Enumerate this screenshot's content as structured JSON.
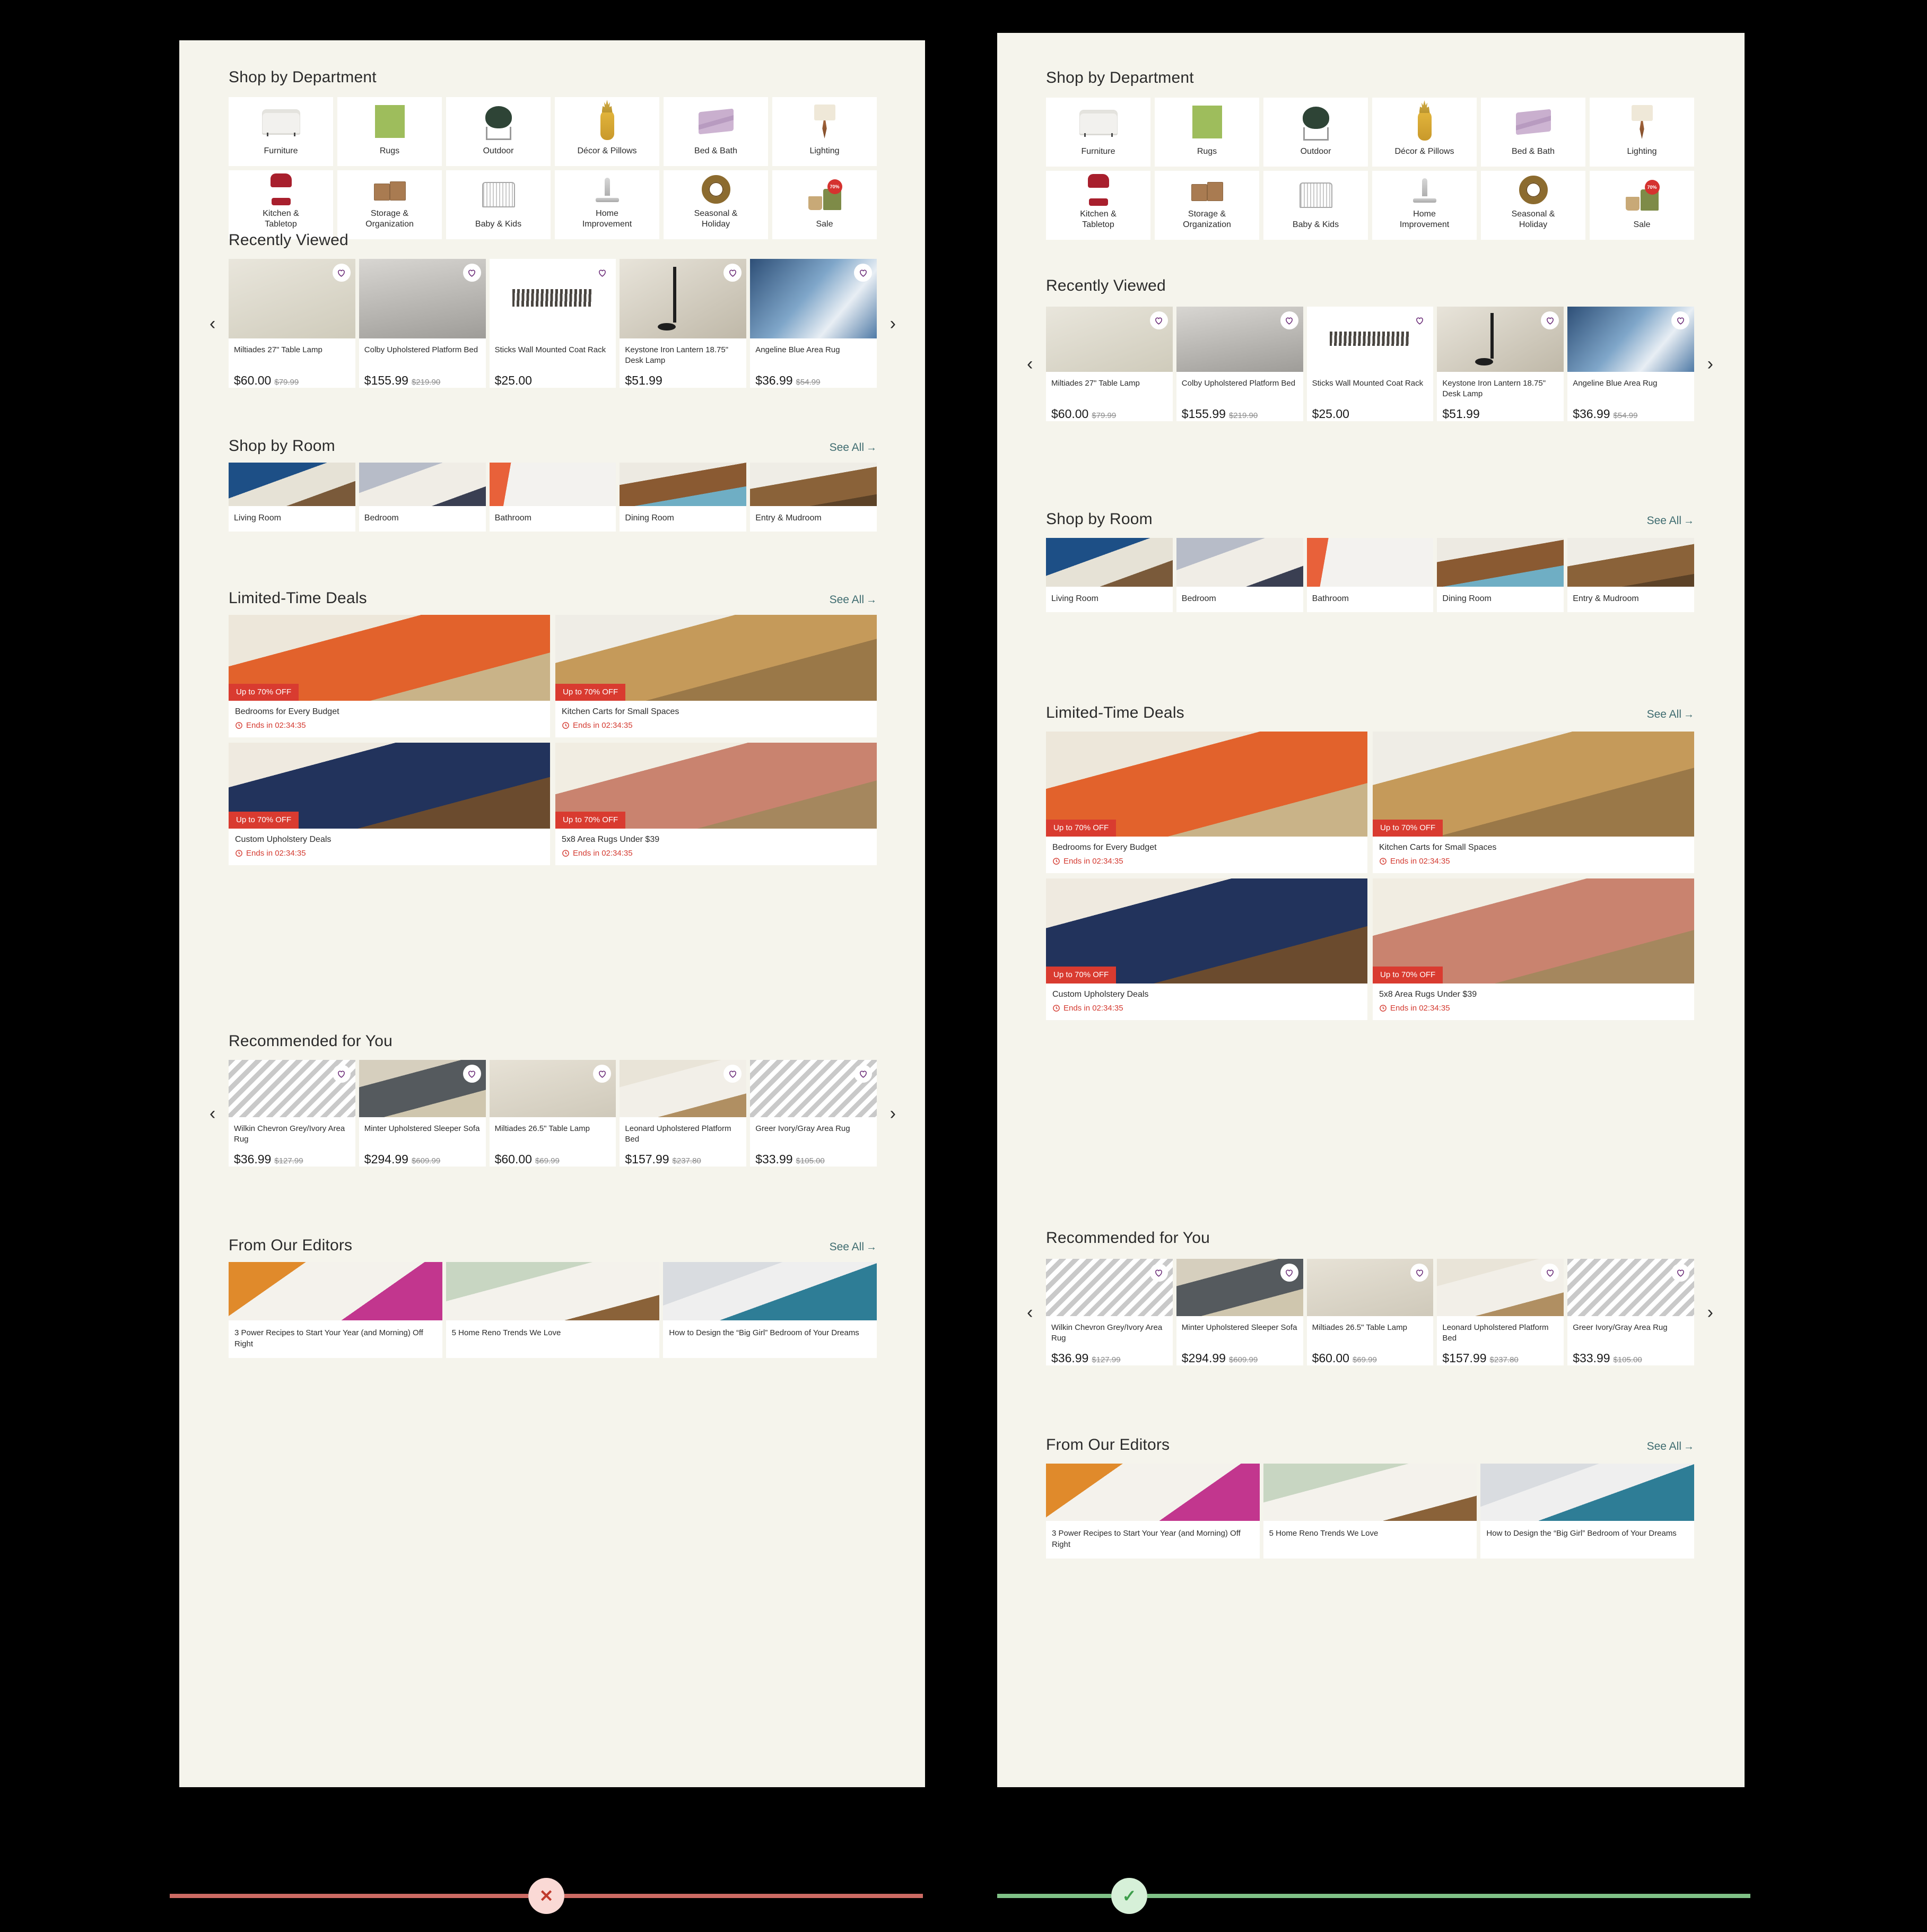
{
  "page": {
    "background_color": "#000000",
    "panel_background": "#F5F4EC",
    "card_background": "#FFFFFF",
    "accent_red": "#D93B30",
    "link_teal": "#3F6C70",
    "heart_purple": "#6B2C78"
  },
  "sections": {
    "department": {
      "title": "Shop by Department"
    },
    "recently_viewed": {
      "title": "Recently Viewed"
    },
    "shop_by_room": {
      "title": "Shop by Room",
      "see_all": "See All",
      "see_all_arrow": "→"
    },
    "limited_deals": {
      "title": "Limited-Time Deals",
      "see_all": "See All",
      "see_all_arrow": "→"
    },
    "recommended": {
      "title": "Recommended for You"
    },
    "editors": {
      "title": "From Our Editors",
      "see_all": "See All",
      "see_all_arrow": "→"
    }
  },
  "departments": [
    {
      "label": "Furniture",
      "icon": "sofa-icon"
    },
    {
      "label": "Rugs",
      "icon": "rug-icon"
    },
    {
      "label": "Outdoor",
      "icon": "grill-icon"
    },
    {
      "label": "Décor & Pillows",
      "icon": "pineapple-icon"
    },
    {
      "label": "Bed & Bath",
      "icon": "sheets-icon"
    },
    {
      "label": "Lighting",
      "icon": "lamp-icon"
    },
    {
      "label": "Kitchen &\nTabletop",
      "icon": "mixer-icon"
    },
    {
      "label": "Storage &\nOrganization",
      "icon": "bins-icon"
    },
    {
      "label": "Baby & Kids",
      "icon": "crib-icon"
    },
    {
      "label": "Home\nImprovement",
      "icon": "faucet-icon"
    },
    {
      "label": "Seasonal &\nHoliday",
      "icon": "wreath-icon"
    },
    {
      "label": "Sale",
      "icon": "sale-chair-icon",
      "badge": "up to\n70%\noff"
    }
  ],
  "recently_viewed": [
    {
      "name": "Miltiades 27\" Table Lamp",
      "price": "$60.00",
      "was": "$79.99",
      "scene": "sc-lamp-room",
      "heart": true,
      "heart_circle": true
    },
    {
      "name": "Colby Upholstered Platform Bed",
      "price": "$155.99",
      "was": "$219.90",
      "scene": "sc-bed-gray",
      "heart": true,
      "heart_circle": true
    },
    {
      "name": "Sticks Wall Mounted Coat Rack",
      "price": "$25.00",
      "was": "",
      "scene": "sc-coatrack",
      "heart": true,
      "heart_circle": false
    },
    {
      "name": "Keystone Iron Lantern 18.75\" Desk Lamp",
      "price": "$51.99",
      "was": "",
      "scene": "sc-desklamp",
      "heart": true,
      "heart_circle": true
    },
    {
      "name": "Angeline Blue Area Rug",
      "price": "$36.99",
      "was": "$54.99",
      "scene": "sc-bluerug",
      "heart": true,
      "heart_circle": true
    }
  ],
  "rooms": [
    {
      "label": "Living Room",
      "scene": "sc-living"
    },
    {
      "label": "Bedroom",
      "scene": "sc-bedroom"
    },
    {
      "label": "Bathroom",
      "scene": "sc-bath"
    },
    {
      "label": "Dining Room",
      "scene": "sc-dining"
    },
    {
      "label": "Entry & Mudroom",
      "scene": "sc-entry"
    }
  ],
  "deals": [
    {
      "title": "Bedrooms for Every Budget",
      "badge": "Up to 70% OFF",
      "timer": "Ends in 02:34:35",
      "scene": "sc-deal-bed"
    },
    {
      "title": "Kitchen Carts for Small Spaces",
      "badge": "Up to 70% OFF",
      "timer": "Ends in 02:34:35",
      "scene": "sc-deal-cart"
    },
    {
      "title": "Custom Upholstery Deals",
      "badge": "Up to 70% OFF",
      "timer": "Ends in 02:34:35",
      "scene": "sc-deal-sofa"
    },
    {
      "title": "5x8 Area Rugs Under $39",
      "badge": "Up to 70% OFF",
      "timer": "Ends in 02:34:35",
      "scene": "sc-deal-rug"
    }
  ],
  "recommended": [
    {
      "name": "Wilkin Chevron Grey/Ivory Area Rug",
      "price": "$36.99",
      "was": "$127.99",
      "scene": "sc-chevron"
    },
    {
      "name": "Minter Upholstered Sleeper Sofa",
      "price": "$294.99",
      "was": "$609.99",
      "scene": "sc-sofa-gray"
    },
    {
      "name": "Miltiades 26.5\" Table Lamp",
      "price": "$60.00",
      "was": "$69.99",
      "scene": "sc-lamp-wht"
    },
    {
      "name": "Leonard Upholstered Platform Bed",
      "price": "$157.99",
      "was": "$237.80",
      "scene": "sc-plat-bed"
    },
    {
      "name": "Greer Ivory/Gray Area Rug",
      "price": "$33.99",
      "was": "$105.00",
      "scene": "sc-chevron"
    }
  ],
  "editors": [
    {
      "title": "3 Power Recipes to Start Your Year (and Morning) Off Right",
      "scene": "sc-recipe"
    },
    {
      "title": "5 Home Reno Trends We Love",
      "scene": "sc-reno"
    },
    {
      "title": "How to Design the “Big Girl” Bedroom of Your Dreams",
      "scene": "sc-kitchen"
    }
  ],
  "carousel": {
    "prev": "‹",
    "next": "›"
  },
  "verdict": {
    "left": {
      "symbol": "✕",
      "line_color": "#CC6A63",
      "badge_bg": "#FAD9D5",
      "symbol_color": "#C0392B"
    },
    "right": {
      "symbol": "✓",
      "line_color": "#7FC186",
      "badge_bg": "#D6F0D8",
      "symbol_color": "#3E9E4C"
    }
  }
}
